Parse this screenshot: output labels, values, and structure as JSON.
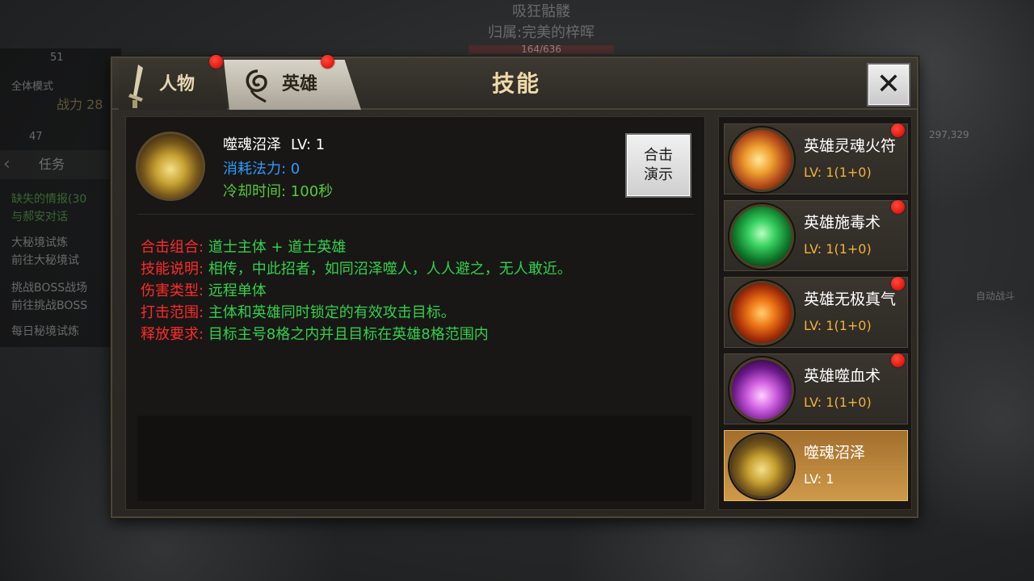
{
  "background": {
    "top_name": "吸狂骷髅",
    "top_subtitle": "归属:完美的梓晖",
    "top_hp": "164/636",
    "left_level": "51",
    "left_mode": "全体模式",
    "left_power": "战力 28",
    "left_num": "47",
    "task_tab": "任务",
    "quests": [
      {
        "title": "缺失的情报(30",
        "desc": "与郝安对话"
      },
      {
        "title": "大秘境试炼",
        "desc": "前往大秘境试"
      },
      {
        "title": "挑战BOSS战场",
        "desc": "前往挑战BOSS"
      },
      {
        "title": "每日秘境试炼",
        "desc": ""
      }
    ],
    "right_hp": "297,329",
    "right_auto": "自动战斗"
  },
  "dialog": {
    "title": "技能",
    "tabs": [
      {
        "label": "人物",
        "icon": "sword-icon",
        "active": false,
        "badge": true
      },
      {
        "label": "英雄",
        "icon": "swirl-icon",
        "active": true,
        "badge": true
      }
    ],
    "close_label": "✕"
  },
  "detail": {
    "icon": "swamp-skill-icon",
    "name": "噬魂沼泽",
    "level": "LV: 1",
    "mana": "消耗法力: 0",
    "cooldown": "冷却时间: 100秒",
    "demo_button": [
      "合击",
      "演示"
    ],
    "info": [
      {
        "key": "合击组合:",
        "value": "道士主体 + 道士英雄"
      },
      {
        "key": "技能说明:",
        "value": "相传，中此招者，如同沼泽噬人，人人避之，无人敢近。"
      },
      {
        "key": "伤害类型:",
        "value": "远程单体"
      },
      {
        "key": "打击范围:",
        "value": "主体和英雄同时锁定的有效攻击目标。"
      },
      {
        "key": "释放要求:",
        "value": "目标主号8格之内并且目标在英雄8格范围内"
      }
    ]
  },
  "skills": [
    {
      "name": "英雄灵魂火符",
      "level": "LV: 1(1+0)",
      "icon": "fire-talisman-icon",
      "badge": true,
      "selected": false
    },
    {
      "name": "英雄施毒术",
      "level": "LV: 1(1+0)",
      "icon": "poison-icon",
      "badge": true,
      "selected": false
    },
    {
      "name": "英雄无极真气",
      "level": "LV: 1(1+0)",
      "icon": "yin-yang-icon",
      "badge": true,
      "selected": false
    },
    {
      "name": "英雄噬血术",
      "level": "LV: 1(1+0)",
      "icon": "blood-demon-icon",
      "badge": true,
      "selected": false
    },
    {
      "name": "噬魂沼泽",
      "level": "LV: 1",
      "icon": "swamp-icon",
      "badge": false,
      "selected": true
    }
  ],
  "colors": {
    "key_red": "#ff2a2a",
    "value_green": "#33d04a",
    "mana_blue": "#2d9cff",
    "level_orange": "#f0b23a",
    "title_gold": "#efd9a8",
    "selected_bg": "#cf9a4a"
  }
}
